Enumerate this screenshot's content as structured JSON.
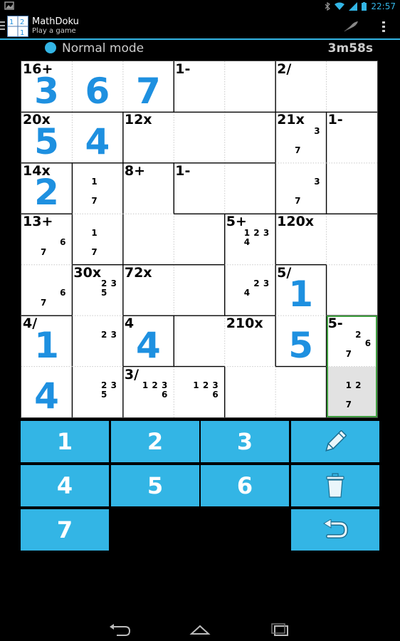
{
  "status_bar": {
    "time": "22:57"
  },
  "app": {
    "title": "MathDoku",
    "subtitle": "Play a game",
    "logo_digits": [
      "1",
      "2",
      "1"
    ]
  },
  "game": {
    "mode": "Normal mode",
    "timer": "3m58s"
  },
  "grid": {
    "size": 7,
    "cage_labels": [
      {
        "row": 0,
        "col": 0,
        "text": "16+"
      },
      {
        "row": 0,
        "col": 3,
        "text": "1-"
      },
      {
        "row": 0,
        "col": 5,
        "text": "2/"
      },
      {
        "row": 1,
        "col": 0,
        "text": "20x"
      },
      {
        "row": 1,
        "col": 2,
        "text": "12x"
      },
      {
        "row": 1,
        "col": 5,
        "text": "21x"
      },
      {
        "row": 1,
        "col": 6,
        "text": "1-"
      },
      {
        "row": 2,
        "col": 0,
        "text": "14x"
      },
      {
        "row": 2,
        "col": 2,
        "text": "8+"
      },
      {
        "row": 2,
        "col": 3,
        "text": "1-"
      },
      {
        "row": 3,
        "col": 0,
        "text": "13+"
      },
      {
        "row": 3,
        "col": 4,
        "text": "5+"
      },
      {
        "row": 3,
        "col": 5,
        "text": "120x"
      },
      {
        "row": 4,
        "col": 1,
        "text": "30x"
      },
      {
        "row": 4,
        "col": 2,
        "text": "72x"
      },
      {
        "row": 4,
        "col": 5,
        "text": "5/"
      },
      {
        "row": 5,
        "col": 0,
        "text": "4/"
      },
      {
        "row": 5,
        "col": 2,
        "text": "4"
      },
      {
        "row": 5,
        "col": 4,
        "text": "210x"
      },
      {
        "row": 5,
        "col": 6,
        "text": "5-"
      },
      {
        "row": 6,
        "col": 2,
        "text": "3/"
      }
    ],
    "values": [
      {
        "row": 0,
        "col": 0,
        "value": "3"
      },
      {
        "row": 0,
        "col": 1,
        "value": "6"
      },
      {
        "row": 0,
        "col": 2,
        "value": "7"
      },
      {
        "row": 1,
        "col": 0,
        "value": "5"
      },
      {
        "row": 1,
        "col": 1,
        "value": "4"
      },
      {
        "row": 2,
        "col": 0,
        "value": "2"
      },
      {
        "row": 4,
        "col": 5,
        "value": "1"
      },
      {
        "row": 5,
        "col": 0,
        "value": "1"
      },
      {
        "row": 5,
        "col": 2,
        "value": "4"
      },
      {
        "row": 5,
        "col": 5,
        "value": "5"
      },
      {
        "row": 6,
        "col": 0,
        "value": "4"
      }
    ],
    "pencil_marks": [
      {
        "row": 1,
        "col": 5,
        "marks": [
          "3",
          "7"
        ]
      },
      {
        "row": 2,
        "col": 1,
        "marks": [
          "1",
          "7"
        ]
      },
      {
        "row": 2,
        "col": 5,
        "marks": [
          "3",
          "7"
        ]
      },
      {
        "row": 3,
        "col": 0,
        "marks": [
          "6",
          "7"
        ]
      },
      {
        "row": 3,
        "col": 1,
        "marks": [
          "1",
          "7"
        ]
      },
      {
        "row": 3,
        "col": 4,
        "marks": [
          "1",
          "2",
          "3",
          "4"
        ]
      },
      {
        "row": 4,
        "col": 0,
        "marks": [
          "6",
          "7"
        ]
      },
      {
        "row": 4,
        "col": 1,
        "marks": [
          "2",
          "3",
          "5"
        ]
      },
      {
        "row": 4,
        "col": 4,
        "marks": [
          "2",
          "3",
          "4"
        ]
      },
      {
        "row": 5,
        "col": 1,
        "marks": [
          "2",
          "3"
        ]
      },
      {
        "row": 5,
        "col": 6,
        "marks": [
          "2",
          "6",
          "7"
        ]
      },
      {
        "row": 6,
        "col": 1,
        "marks": [
          "2",
          "3",
          "5"
        ]
      },
      {
        "row": 6,
        "col": 2,
        "marks": [
          "1",
          "2",
          "3",
          "6"
        ]
      },
      {
        "row": 6,
        "col": 3,
        "marks": [
          "1",
          "2",
          "3",
          "6"
        ]
      },
      {
        "row": 6,
        "col": 6,
        "marks": [
          "1",
          "2",
          "7"
        ]
      }
    ],
    "cages": [
      [
        0,
        0,
        0,
        1,
        1,
        2,
        2
      ],
      [
        3,
        3,
        4,
        4,
        4,
        5,
        6
      ],
      [
        7,
        8,
        9,
        10,
        10,
        5,
        6
      ],
      [
        11,
        8,
        9,
        9,
        12,
        13,
        13
      ],
      [
        11,
        14,
        15,
        15,
        12,
        16,
        13
      ],
      [
        17,
        14,
        18,
        19,
        19,
        16,
        20
      ],
      [
        17,
        14,
        21,
        21,
        19,
        19,
        20
      ]
    ],
    "selected": {
      "row": 6,
      "col": 6
    }
  },
  "keypad": {
    "digits": [
      "1",
      "2",
      "3",
      "4",
      "5",
      "6",
      "7"
    ],
    "pencil_icon": "pencil-icon",
    "clear_icon": "trash-icon",
    "undo_icon": "undo-icon"
  },
  "navigation": {
    "back_icon": "back-icon",
    "home_icon": "home-icon",
    "recent_icon": "recent-apps-icon"
  },
  "colors": {
    "accent": "#33b5e5",
    "value_text": "#1e90e0",
    "selected_border": "#3f9e3f",
    "selected_bg": "#e2e2e2"
  }
}
